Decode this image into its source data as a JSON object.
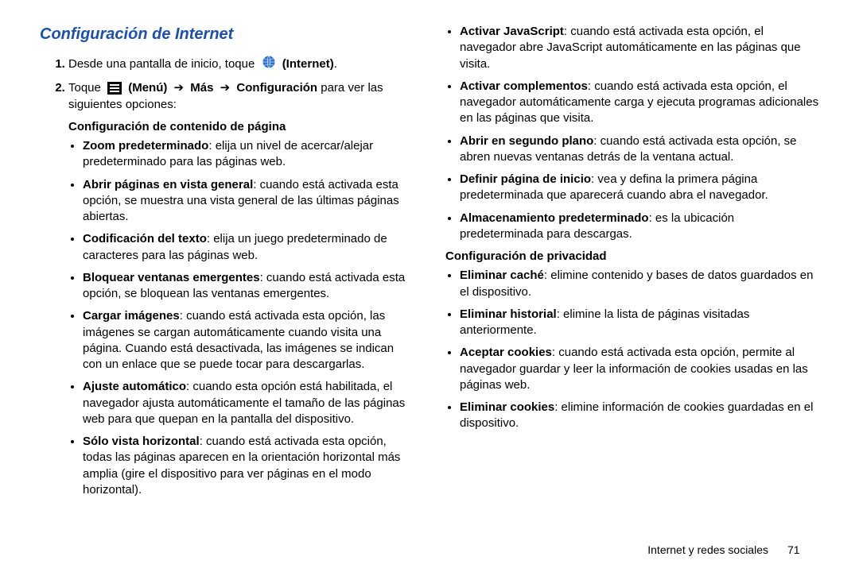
{
  "title": "Configuración de Internet",
  "steps": {
    "s1_a": "Desde una pantalla de inicio, toque ",
    "s1_b": "(Internet)",
    "s1_c": ".",
    "s2_a": "Toque ",
    "s2_b": "(Menú)",
    "s2_arrow1": "➔",
    "s2_c": "Más",
    "s2_arrow2": "➔",
    "s2_d": "Configuración",
    "s2_e": " para ver las siguientes opciones:"
  },
  "sub1": "Configuración de contenido de página",
  "left_items": [
    {
      "b": "Zoom predeterminado",
      "t": ": elija un nivel de acercar/alejar predeterminado para las páginas web."
    },
    {
      "b": "Abrir páginas en vista general",
      "t": ": cuando está activada esta opción, se muestra una vista general de las últimas páginas abiertas."
    },
    {
      "b": "Codificación del texto",
      "t": ": elija un juego predeterminado de caracteres para las páginas web."
    },
    {
      "b": "Bloquear ventanas emergentes",
      "t": ": cuando está activada esta opción, se bloquean las ventanas emergentes."
    },
    {
      "b": "Cargar imágenes",
      "t": ": cuando está activada esta opción, las imágenes se cargan automáticamente cuando visita una página. Cuando está desactivada, las imágenes se indican con un enlace que se puede tocar para descargarlas."
    },
    {
      "b": "Ajuste automático",
      "t": ": cuando esta opción está habilitada, el navegador ajusta automáticamente el tamaño de las páginas web para que quepan en la pantalla del dispositivo."
    },
    {
      "b": "Sólo vista horizontal",
      "t": ": cuando está activada esta opción, todas las páginas aparecen en la orientación horizontal más amplia (gire el dispositivo para ver páginas en el modo horizontal)."
    }
  ],
  "right_top_items": [
    {
      "b": "Activar JavaScript",
      "t": ": cuando está activada esta opción, el navegador abre JavaScript automáticamente en las páginas que visita."
    },
    {
      "b": "Activar complementos",
      "t": ": cuando está activada esta opción, el navegador automáticamente carga y ejecuta programas adicionales en las páginas que visita."
    },
    {
      "b": "Abrir en segundo plano",
      "t": ": cuando está activada esta opción, se abren nuevas ventanas detrás de la ventana actual."
    },
    {
      "b": "Definir página de inicio",
      "t": ": vea y defina la primera página predeterminada que aparecerá cuando abra el navegador."
    },
    {
      "b": "Almacenamiento predeterminado",
      "t": ": es la ubicación predeterminada para descargas."
    }
  ],
  "sub2": "Configuración de privacidad",
  "right_bottom_items": [
    {
      "b": "Eliminar caché",
      "t": ": elimine contenido y bases de datos guardados en el dispositivo."
    },
    {
      "b": "Eliminar historial",
      "t": ": elimine la lista de páginas visitadas anteriormente."
    },
    {
      "b": "Aceptar cookies",
      "t": ": cuando está activada esta opción, permite al navegador guardar y leer la información de cookies usadas en las páginas web."
    },
    {
      "b": "Eliminar cookies",
      "t": ": elimine información de cookies guardadas en el dispositivo."
    }
  ],
  "footer": {
    "section": "Internet y redes sociales",
    "page": "71"
  }
}
